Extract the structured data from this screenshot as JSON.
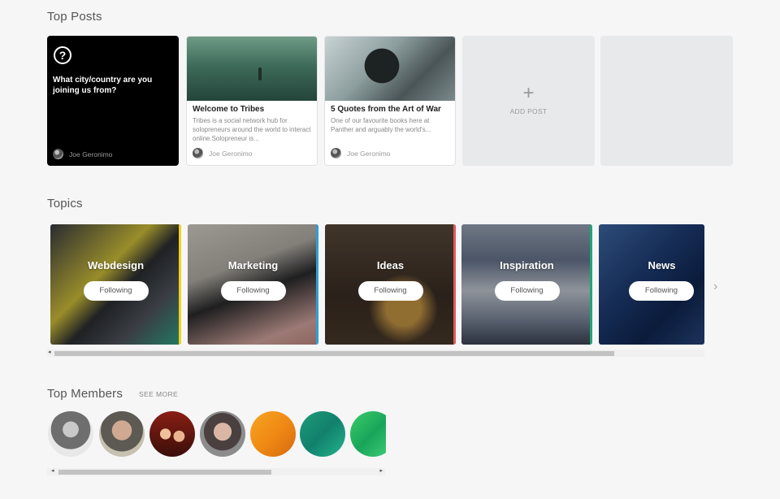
{
  "top_posts": {
    "title": "Top Posts",
    "question_card": {
      "icon": "question-icon",
      "icon_glyph": "?",
      "text": "What city/country are you joining us from?",
      "author": "Joe Geronimo"
    },
    "posts": [
      {
        "title": "Welcome to Tribes",
        "excerpt": "Tribes is a social network hub for solopreneurs around the world to interact online.Solopreneur is...",
        "author": "Joe Geronimo"
      },
      {
        "title": "5 Quotes from the Art of War",
        "excerpt": "One of our favourite books here at Panther and arguably the world's...",
        "author": "Joe Geronimo"
      }
    ],
    "add_post": {
      "icon": "plus-icon",
      "icon_glyph": "+",
      "label": "ADD POST"
    }
  },
  "topics": {
    "title": "Topics",
    "items": [
      {
        "name": "Webdesign",
        "button": "Following",
        "accent": "#f2d11b"
      },
      {
        "name": "Marketing",
        "button": "Following",
        "accent": "#2e9fd8"
      },
      {
        "name": "Ideas",
        "button": "Following",
        "accent": "#e05a5a"
      },
      {
        "name": "Inspiration",
        "button": "Following",
        "accent": "#1fa67a"
      },
      {
        "name": "News",
        "button": "Following",
        "accent": "#3f6aa8"
      }
    ],
    "next_icon": "chevron-right-icon",
    "next_glyph": "›"
  },
  "top_members": {
    "title": "Top Members",
    "see_more": "SEE MORE"
  }
}
